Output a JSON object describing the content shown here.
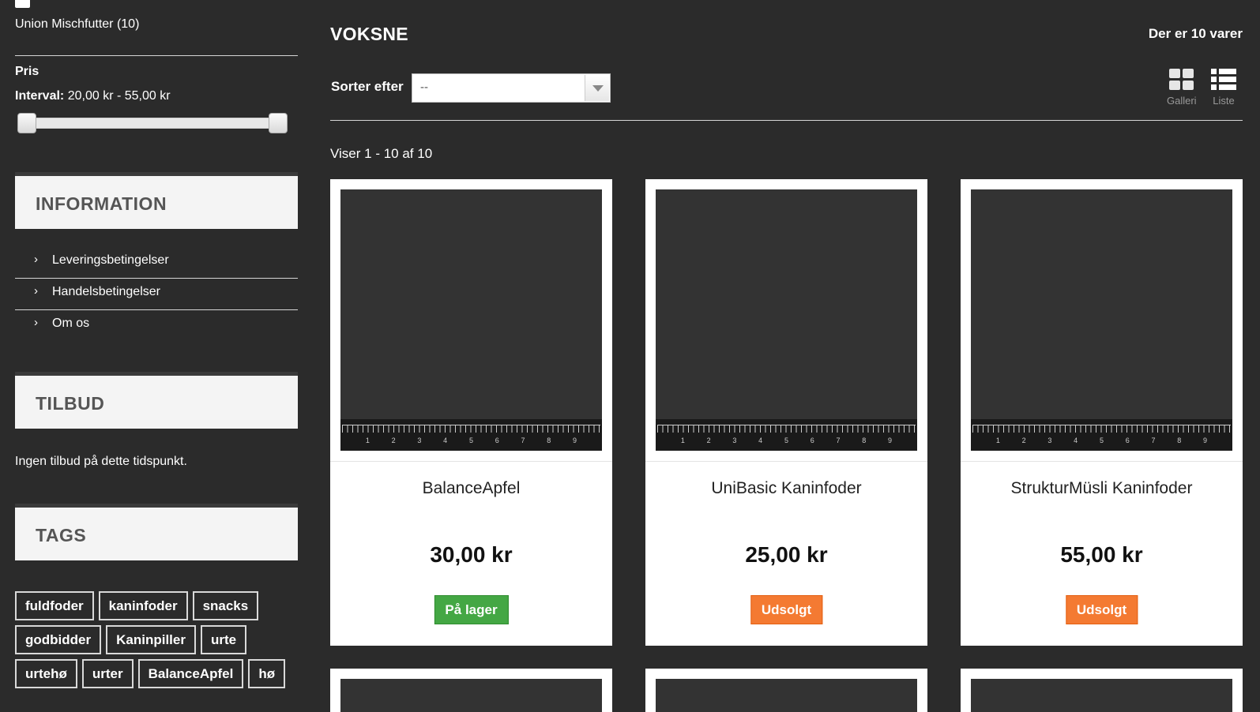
{
  "sidebar": {
    "manufacturer_label": "Union Mischfutter (10)",
    "price_title": "Pris",
    "price_interval_label": "Interval:",
    "price_interval_value": "20,00 kr - 55,00 kr",
    "price_range_min_fraction": 0.0,
    "price_range_max_fraction": 1.0,
    "information_title": "INFORMATION",
    "information_links": [
      {
        "label": "Leveringsbetingelser"
      },
      {
        "label": "Handelsbetingelser"
      },
      {
        "label": "Om os"
      }
    ],
    "offers_title": "TILBUD",
    "offers_text": "Ingen tilbud på dette tidspunkt.",
    "tags_title": "TAGS",
    "tags": [
      "fuldfoder",
      "kaninfoder",
      "snacks",
      "godbidder",
      "Kaninpiller",
      "urte",
      "urtehø",
      "urter",
      "BalanceApfel",
      "hø"
    ],
    "chevron_glyph": "›"
  },
  "main": {
    "title": "VOKSNE",
    "item_count": "Der er 10 varer",
    "sort_label": "Sorter efter",
    "sort_value": "--",
    "view_gallery": "Galleri",
    "view_list": "Liste",
    "showing": "Viser 1 - 10 af 10",
    "ruler_numbers": [
      "1",
      "2",
      "3",
      "4",
      "5",
      "6",
      "7",
      "8",
      "9"
    ],
    "products": [
      {
        "name": "BalanceApfel",
        "price": "30,00 kr",
        "stock": "På lager",
        "stock_color": "#44a744"
      },
      {
        "name": "UniBasic Kaninfoder",
        "price": "25,00 kr",
        "stock": "Udsolgt",
        "stock_color": "#f47a32"
      },
      {
        "name": "StrukturMüsli Kaninfoder",
        "price": "55,00 kr",
        "stock": "Udsolgt",
        "stock_color": "#f47a32"
      }
    ]
  },
  "icons": {
    "gallery": "grid-icon",
    "list": "list-icon",
    "chevron": "chevron-right-icon",
    "dropdown": "caret-down-icon"
  }
}
